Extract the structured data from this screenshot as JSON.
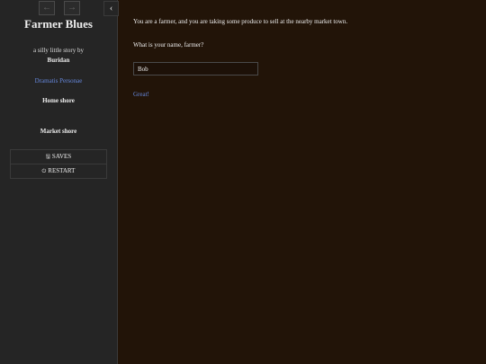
{
  "history": {
    "back_icon": "arrow-left",
    "forward_icon": "arrow-right"
  },
  "toggle": {
    "icon": "chevron-left",
    "glyph": "‹"
  },
  "sidebar": {
    "title": "Farmer Blues",
    "subtitle": "a silly little story by",
    "author": "Buridan",
    "links": [
      "Dramatis Personae"
    ],
    "nav": [
      "Home shore",
      "Market shore"
    ],
    "menu": {
      "saves_label": "SAVES",
      "restart_label": "RESTART"
    }
  },
  "passage": {
    "intro": "You are a farmer, and you are taking some produce to sell at the nearby market town.",
    "question": "What is your name, farmer?",
    "name_value": "Bob",
    "continue_link": "Great!"
  },
  "colors": {
    "sidebar_bg": "#252525",
    "passage_bg": "#221408",
    "link": "#6688dd",
    "text": "#eeeeee"
  }
}
